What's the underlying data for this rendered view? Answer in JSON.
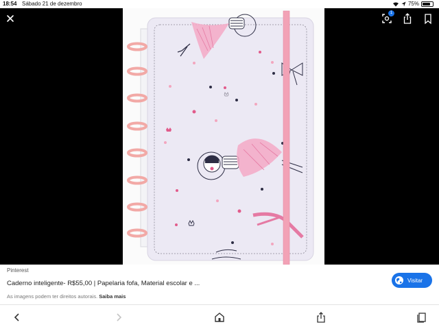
{
  "status": {
    "time": "18:54",
    "date": "Sábado 21 de dezembro",
    "battery": "75%",
    "battery_level": 0.75
  },
  "viewer": {
    "lens_badge": "1",
    "icons": [
      "close-icon",
      "lens-icon",
      "share-icon",
      "bookmark-icon"
    ]
  },
  "info": {
    "source": "Pinterest",
    "title": "Caderno inteligente- R$55,00 | Papelaria fofa, Material escolar e ...",
    "copyright": "As imagens podem ter direitos autorais.",
    "learn_more": "Saiba mais",
    "visit_label": "Visitar"
  },
  "nav": {
    "icons": [
      "back-icon",
      "forward-icon",
      "home-icon",
      "share-icon",
      "tabs-icon"
    ]
  },
  "colors": {
    "accent": "#1a73e8",
    "cover": "#ece9f4",
    "ring": "#f2a9a6",
    "elastic": "#f2a2b6"
  }
}
